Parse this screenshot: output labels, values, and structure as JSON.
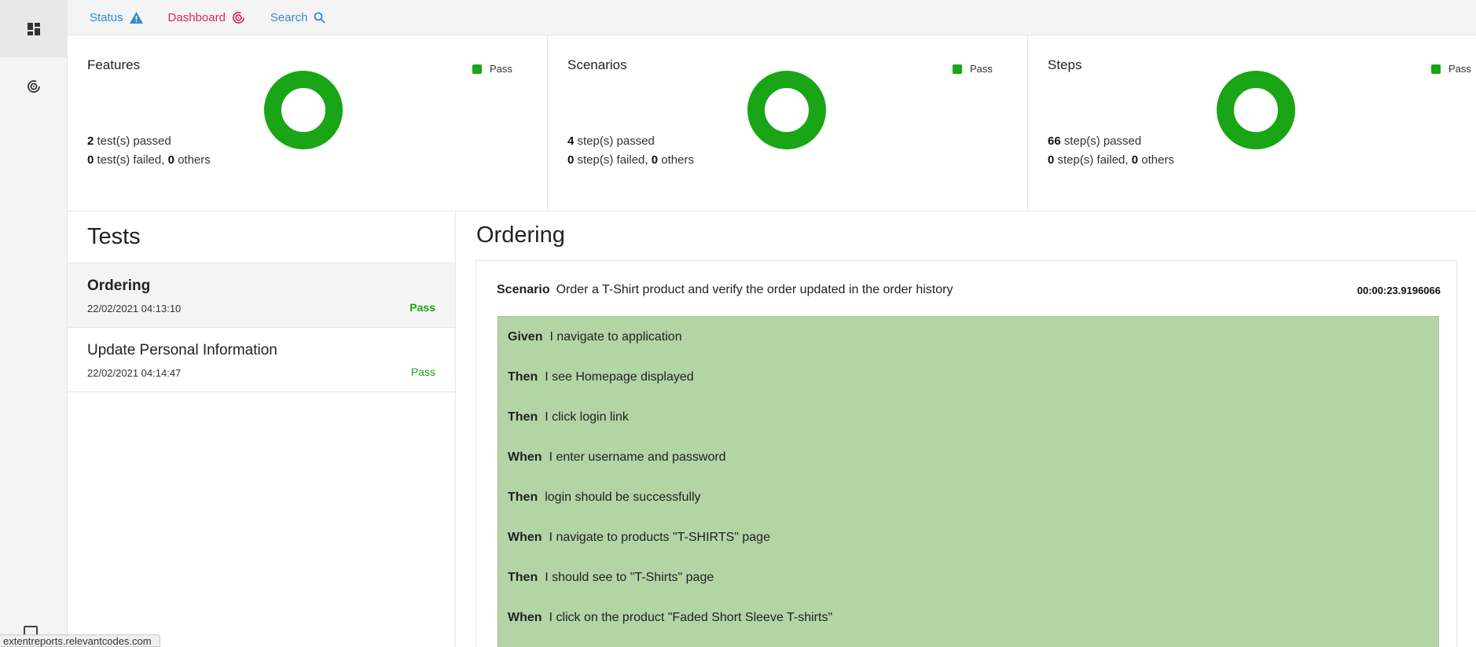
{
  "colors": {
    "pass": "#19a515",
    "steps_bg": "#b3d5a6",
    "status_accent": "#2f8bd8",
    "dashboard_accent": "#e0245e"
  },
  "topnav": {
    "status": {
      "label": "Status",
      "icon": "warning-icon"
    },
    "dashboard": {
      "label": "Dashboard",
      "icon": "dashboard-icon"
    },
    "search": {
      "label": "Search",
      "icon": "search-icon"
    }
  },
  "sidebar": {
    "items": [
      {
        "icon": "dashboard-grid-icon"
      },
      {
        "icon": "dashboard-icon"
      }
    ]
  },
  "summary": {
    "features": {
      "title": "Features",
      "legend": "Pass",
      "passed": "2",
      "passed_text": "test(s) passed",
      "failed": "0",
      "failed_text": "test(s) failed,",
      "others": "0",
      "others_text": "others",
      "pass_fraction": 1.0
    },
    "scenarios": {
      "title": "Scenarios",
      "legend": "Pass",
      "passed": "4",
      "passed_text": "step(s) passed",
      "failed": "0",
      "failed_text": "step(s) failed,",
      "others": "0",
      "others_text": "others",
      "pass_fraction": 1.0
    },
    "steps": {
      "title": "Steps",
      "legend": "Pass",
      "passed": "66",
      "passed_text": "step(s) passed",
      "failed": "0",
      "failed_text": "step(s) failed,",
      "others": "0",
      "others_text": "others",
      "pass_fraction": 1.0
    }
  },
  "tests": {
    "heading": "Tests",
    "items": [
      {
        "name": "Ordering",
        "date": "22/02/2021 04:13:10",
        "status": "Pass"
      },
      {
        "name": "Update Personal Information",
        "date": "22/02/2021 04:14:47",
        "status": "Pass"
      }
    ]
  },
  "detail": {
    "title": "Ordering",
    "scenario_label": "Scenario",
    "scenario_name": "Order a T-Shirt product and verify the order updated in the order history",
    "duration": "00:00:23.9196066",
    "steps": [
      {
        "keyword": "Given",
        "text": "I navigate to application"
      },
      {
        "keyword": "Then",
        "text": "I see Homepage displayed"
      },
      {
        "keyword": "Then",
        "text": "I click login link"
      },
      {
        "keyword": "When",
        "text": "I enter username and password"
      },
      {
        "keyword": "Then",
        "text": "login should be successfully"
      },
      {
        "keyword": "When",
        "text": "I navigate to products \"T-SHIRTS\" page"
      },
      {
        "keyword": "Then",
        "text": "I should see to \"T-Shirts\" page"
      },
      {
        "keyword": "When",
        "text": "I click on the product \"Faded Short Sleeve T-shirts\""
      }
    ]
  },
  "statusbar": {
    "url": "extentreports.relevantcodes.com"
  }
}
